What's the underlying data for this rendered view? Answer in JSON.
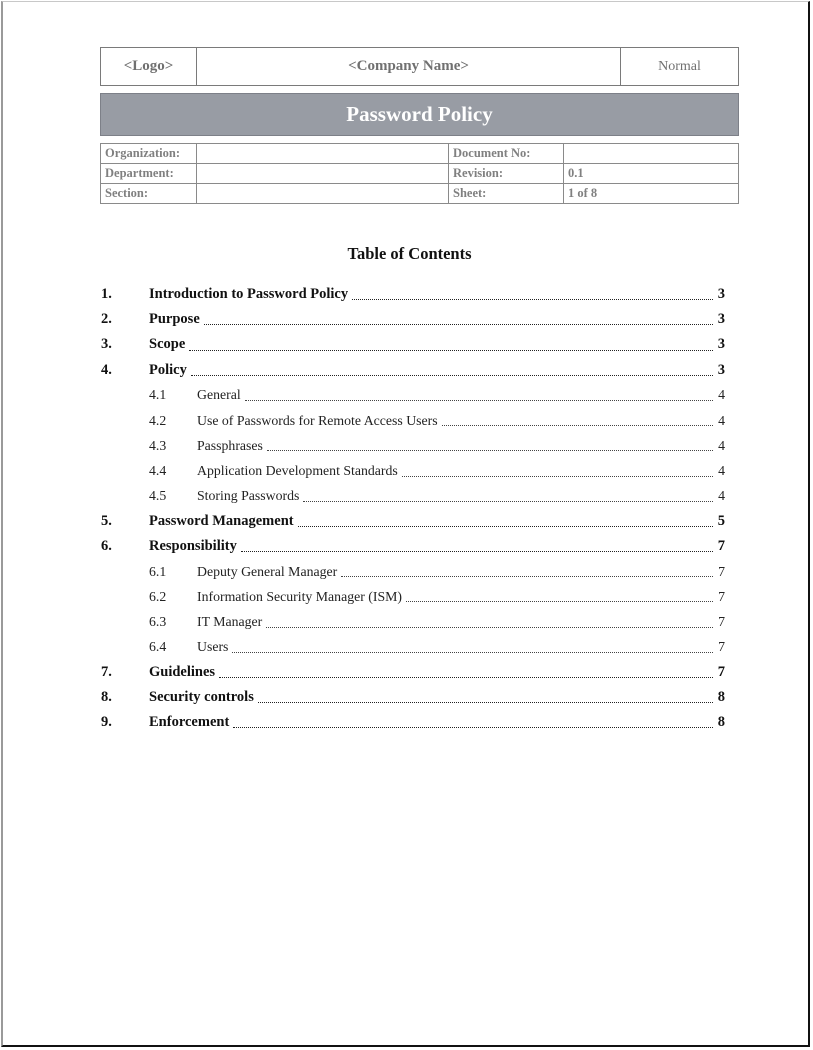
{
  "header": {
    "logo": "<Logo>",
    "company": "<Company Name>",
    "classification": "Normal"
  },
  "title": "Password Policy",
  "info": {
    "organization_label": "Organization:",
    "organization_value": "",
    "document_no_label": "Document No:",
    "document_no_value": "",
    "department_label": "Department:",
    "department_value": "",
    "revision_label": "Revision:",
    "revision_value": "0.1",
    "section_label": "Section:",
    "section_value": "",
    "sheet_label": "Sheet:",
    "sheet_value": "1 of 8"
  },
  "toc": {
    "title": "Table of Contents",
    "entries": [
      {
        "num": "1.",
        "text": "Introduction to Password Policy",
        "page": "3",
        "level": 1
      },
      {
        "num": "2.",
        "text": "Purpose",
        "page": "3",
        "level": 1
      },
      {
        "num": "3.",
        "text": "Scope",
        "page": "3",
        "level": 1
      },
      {
        "num": "4.",
        "text": "Policy",
        "page": "3",
        "level": 1
      },
      {
        "num": "4.1",
        "text": "General",
        "page": "4",
        "level": 2
      },
      {
        "num": "4.2",
        "text": "Use of Passwords for Remote Access Users",
        "page": "4",
        "level": 2
      },
      {
        "num": "4.3",
        "text": "Passphrases",
        "page": "4",
        "level": 2
      },
      {
        "num": "4.4",
        "text": "Application Development Standards",
        "page": "4",
        "level": 2
      },
      {
        "num": "4.5",
        "text": "Storing Passwords",
        "page": "4",
        "level": 2
      },
      {
        "num": "5.",
        "text": "Password Management",
        "page": "5",
        "level": 1
      },
      {
        "num": "6.",
        "text": "Responsibility",
        "page": "7",
        "level": 1
      },
      {
        "num": "6.1",
        "text": "Deputy General Manager",
        "page": "7",
        "level": 2
      },
      {
        "num": "6.2",
        "text": "Information Security Manager (ISM)",
        "page": "7",
        "level": 2
      },
      {
        "num": "6.3",
        "text": "IT Manager",
        "page": "7",
        "level": 2
      },
      {
        "num": "6.4",
        "text": "Users",
        "page": "7",
        "level": 2
      },
      {
        "num": "7.",
        "text": "Guidelines",
        "page": "7",
        "level": 1
      },
      {
        "num": "8.",
        "text": "Security controls",
        "page": "8",
        "level": 1
      },
      {
        "num": "9.",
        "text": "Enforcement",
        "page": "8",
        "level": 1
      }
    ]
  }
}
